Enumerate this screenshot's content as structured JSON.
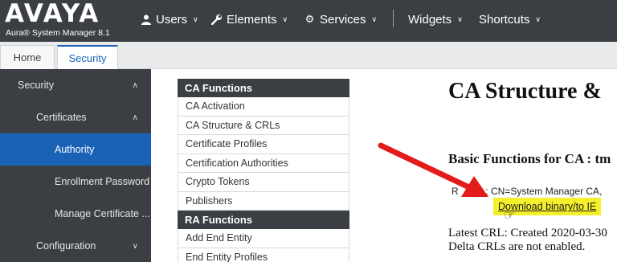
{
  "brand": {
    "logo": "AVAYA",
    "product": "Aura® System Manager 8.1"
  },
  "topnav": [
    {
      "label": "Users",
      "icon": "user-icon"
    },
    {
      "label": "Elements",
      "icon": "wrench-icon"
    },
    {
      "label": "Services",
      "icon": "gear-icon"
    },
    {
      "label": "Widgets"
    },
    {
      "label": "Shortcuts"
    }
  ],
  "tabs": {
    "home": "Home",
    "security": "Security"
  },
  "sidebar": {
    "items": [
      {
        "label": "Security"
      },
      {
        "label": "Certificates"
      },
      {
        "label": "Authority"
      },
      {
        "label": "Enrollment Password"
      },
      {
        "label": "Manage Certificate ..."
      },
      {
        "label": "Configuration"
      }
    ]
  },
  "ca_functions": {
    "header": "CA Functions",
    "items": [
      "CA Activation",
      "CA Structure & CRLs",
      "Certificate Profiles",
      "Certification Authorities",
      "Crypto Tokens",
      "Publishers"
    ]
  },
  "ra_functions": {
    "header": "RA Functions",
    "items": [
      "Add End Entity",
      "End Entity Profiles"
    ]
  },
  "main": {
    "title": "CA Structure &",
    "basic_functions": "Basic Functions for CA : tm",
    "ra_prefix": "R",
    "ra_text": "A : CN=System Manager CA,",
    "download_link": "Download binary/to IE",
    "latest_crl": "Latest CRL: Created 2020-03-30",
    "delta_crl": "Delta CRLs are not enabled."
  },
  "colors": {
    "topbar": "#3b3f44",
    "active": "#1a62b5",
    "highlight": "#f5f02c",
    "arrow": "#e31b1b"
  }
}
